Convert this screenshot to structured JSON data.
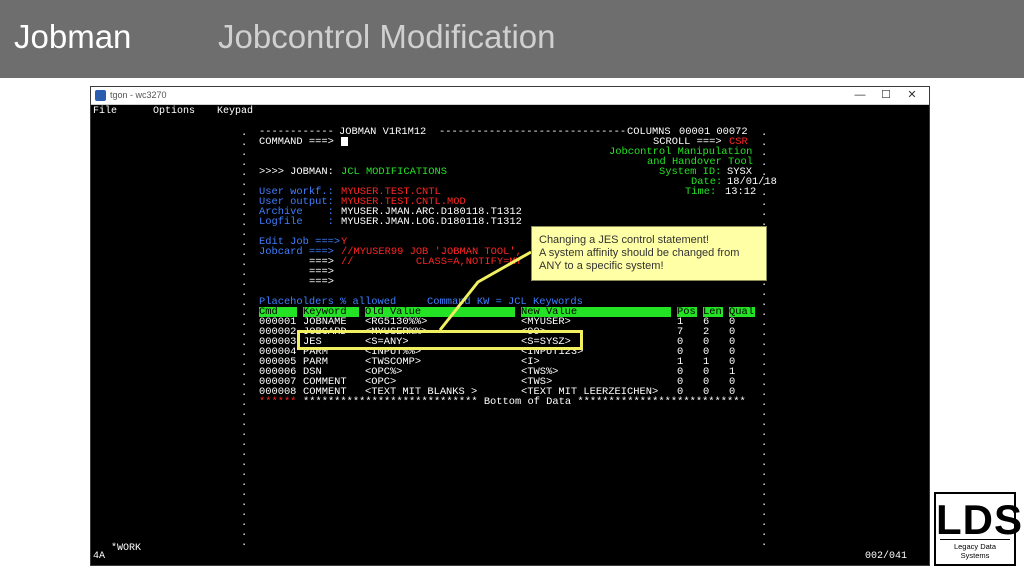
{
  "slide": {
    "brand": "Jobman",
    "title": "Jobcontrol Modification"
  },
  "window": {
    "title": "tgon - wc3270",
    "controls": {
      "minimize": "—",
      "maximize": "☐",
      "close": "✕"
    }
  },
  "menu": [
    "File",
    "Options",
    "Keypad"
  ],
  "terminal": {
    "banner_left": "------------",
    "banner_title": "JOBMAN V1R1M12",
    "banner_right": "------------------------------",
    "columns_label": "COLUMNS",
    "columns_value": "00001 00072",
    "command_label": "COMMAND ===>",
    "scroll_label": "SCROLL ===>",
    "scroll_value": "CSR",
    "tool_line1": "Jobcontrol Manipulation",
    "tool_line2": "and Handover Tool",
    "system_label": "System ID:",
    "system_value": "SYSX",
    "date_label": "Date:",
    "date_value": "18/01/18",
    "time_label": "Time:",
    "time_value": "13:12",
    "section_prefix": ">>>> JOBMAN:",
    "section_value": "JCL MODIFICATIONS",
    "user_workf_label": "User workf.:",
    "user_workf_value": "MYUSER.TEST.CNTL",
    "user_output_label": "User output:",
    "user_output_value": "MYUSER.TEST.CNTL.MOD",
    "archive_label": "Archive    :",
    "archive_value": "MYUSER.JMAN.ARC.D180118.T1312",
    "logfile_label": "Logfile    :",
    "logfile_value": "MYUSER.JMAN.LOG.D180118.T1312",
    "edit_job_label": "Edit Job ===>",
    "edit_job_value": "Y",
    "jobcard_label": "Jobcard ===>",
    "jobcard_line1": "//MYUSER99 JOB 'JOBMAN TOOL',",
    "jobcard_line2": "//          CLASS=A,NOTIFY=MY",
    "arrow": "===>",
    "placeholders_label": "Placeholders % allowed",
    "command_kw_label": "Command KW = JCL Keywords",
    "table_headers": {
      "cmd": "Cmd",
      "keyword": "Keyword",
      "old_value": "Old Value",
      "new_value": "New Value",
      "pos": "Pos",
      "len": "Len",
      "qual": "Qual"
    },
    "rows": [
      {
        "num": "000001",
        "keyword": "JOBNAME",
        "old": "<RG5130%%>",
        "new": "<MYUSER>",
        "pos": "1",
        "len": "6",
        "qual": "0"
      },
      {
        "num": "000002",
        "keyword": "JOBCARD",
        "old": "<MYUSER%%>",
        "new": "<99>",
        "pos": "7",
        "len": "2",
        "qual": "0"
      },
      {
        "num": "000003",
        "keyword": "JES",
        "old": "<S=ANY>",
        "new": "<S=SYSZ>",
        "pos": "0",
        "len": "0",
        "qual": "0"
      },
      {
        "num": "000004",
        "keyword": "PARM",
        "old": "<INPUT%%>",
        "new": "<INPUT123>",
        "pos": "0",
        "len": "0",
        "qual": "0"
      },
      {
        "num": "000005",
        "keyword": "PARM",
        "old": "<TWSCOMP>",
        "new": "<I>",
        "pos": "1",
        "len": "1",
        "qual": "0"
      },
      {
        "num": "000006",
        "keyword": "DSN",
        "old": "<OPC%>",
        "new": "<TWS%>",
        "pos": "0",
        "len": "0",
        "qual": "1"
      },
      {
        "num": "000007",
        "keyword": "COMMENT",
        "old": "<OPC>",
        "new": "<TWS>",
        "pos": "0",
        "len": "0",
        "qual": "0"
      },
      {
        "num": "000008",
        "keyword": "COMMENT",
        "old": "<TEXT MIT BLANKS >",
        "new": "<TEXT MIT LEERZEICHEN>",
        "pos": "0",
        "len": "0",
        "qual": "0"
      }
    ],
    "bottom_stars": "******",
    "bottom_text": "**************************** Bottom of Data ***************************",
    "status_left": "4A",
    "status_work": "*WORK",
    "status_right": "002/041"
  },
  "callout": {
    "line1": "Changing a JES control statement!",
    "line2": "A system affinity should be changed from",
    "line3": "ANY to a specific system!"
  },
  "logo": {
    "mark": "LDS",
    "sub": "Legacy Data Systems"
  },
  "colors": {
    "terminal_green": "#24e324",
    "terminal_blue": "#3f7fff",
    "terminal_red": "#ff2424",
    "highlight": "#f0f060",
    "callout_bg": "#ffffa6",
    "header_bg": "#6e6e6e"
  }
}
